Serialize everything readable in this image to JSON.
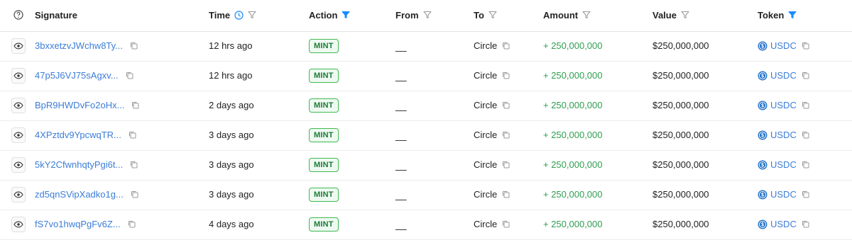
{
  "headers": {
    "signature": "Signature",
    "time": "Time",
    "action": "Action",
    "from": "From",
    "to": "To",
    "amount": "Amount",
    "value": "Value",
    "token": "Token"
  },
  "rows": [
    {
      "signature": "3bxxetzvJWchw8Ty...",
      "time": "12 hrs ago",
      "action": "MINT",
      "from": "__",
      "to": "Circle",
      "amount": "+ 250,000,000",
      "value": "$250,000,000",
      "token": "USDC"
    },
    {
      "signature": "47p5J6VJ75sAgxv...",
      "time": "12 hrs ago",
      "action": "MINT",
      "from": "__",
      "to": "Circle",
      "amount": "+ 250,000,000",
      "value": "$250,000,000",
      "token": "USDC"
    },
    {
      "signature": "BpR9HWDvFo2oHx...",
      "time": "2 days ago",
      "action": "MINT",
      "from": "__",
      "to": "Circle",
      "amount": "+ 250,000,000",
      "value": "$250,000,000",
      "token": "USDC"
    },
    {
      "signature": "4XPztdv9YpcwqTR...",
      "time": "3 days ago",
      "action": "MINT",
      "from": "__",
      "to": "Circle",
      "amount": "+ 250,000,000",
      "value": "$250,000,000",
      "token": "USDC"
    },
    {
      "signature": "5kY2CfwnhqtyPgi6t...",
      "time": "3 days ago",
      "action": "MINT",
      "from": "__",
      "to": "Circle",
      "amount": "+ 250,000,000",
      "value": "$250,000,000",
      "token": "USDC"
    },
    {
      "signature": "zd5qnSVipXadko1g...",
      "time": "3 days ago",
      "action": "MINT",
      "from": "__",
      "to": "Circle",
      "amount": "+ 250,000,000",
      "value": "$250,000,000",
      "token": "USDC"
    },
    {
      "signature": "fS7vo1hwqPgFv6Z...",
      "time": "4 days ago",
      "action": "MINT",
      "from": "__",
      "to": "Circle",
      "amount": "+ 250,000,000",
      "value": "$250,000,000",
      "token": "USDC"
    }
  ],
  "icons": {
    "help": "help-circle-icon",
    "clock": "clock-icon",
    "filter": "filter-icon",
    "eye": "eye-icon",
    "copy": "copy-icon",
    "usdc": "usdc-coin-icon"
  },
  "colors": {
    "link": "#3b7dd8",
    "amount_positive": "#2e9e4f",
    "mint_badge_border": "#3fb950",
    "mint_badge_text": "#1d7a35",
    "filter_active": "#1a8cff",
    "filter_inactive": "#9a9a9a"
  }
}
